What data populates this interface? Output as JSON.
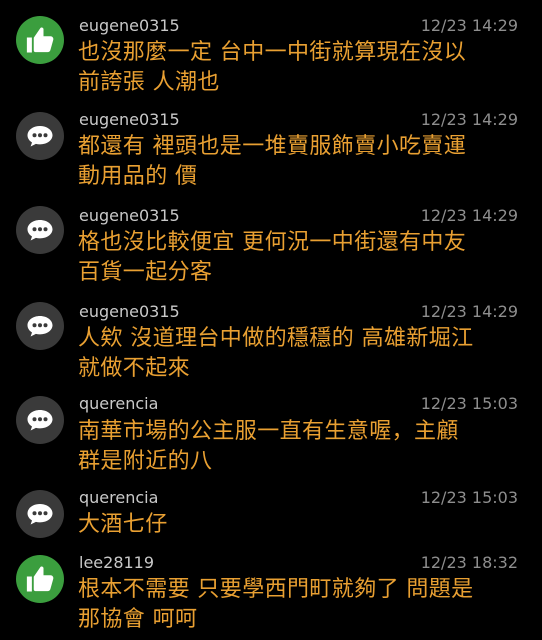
{
  "comments": [
    {
      "type": "push",
      "avatar_icon": "thumbs-up-icon",
      "user": "eugene0315",
      "time": "12/23 14:29",
      "lines": [
        "也沒那麼一定 台中一中街就算現在沒以",
        "前誇張 人潮也"
      ]
    },
    {
      "type": "neutral",
      "avatar_icon": "speech-bubble-icon",
      "user": "eugene0315",
      "time": "12/23 14:29",
      "lines": [
        "都還有 裡頭也是一堆賣服飾賣小吃賣運",
        "動用品的 價"
      ]
    },
    {
      "type": "neutral",
      "avatar_icon": "speech-bubble-icon",
      "user": "eugene0315",
      "time": "12/23 14:29",
      "lines": [
        "格也沒比較便宜 更何況一中街還有中友",
        "百貨一起分客"
      ]
    },
    {
      "type": "neutral",
      "avatar_icon": "speech-bubble-icon",
      "user": "eugene0315",
      "time": "12/23 14:29",
      "lines": [
        "人欸 沒道理台中做的穩穩的 高雄新堀江",
        "就做不起來"
      ]
    },
    {
      "type": "neutral",
      "avatar_icon": "speech-bubble-icon",
      "user": "querencia",
      "time": "12/23 15:03",
      "lines": [
        "南華市場的公主服一直有生意喔，主顧",
        "群是附近的八"
      ]
    },
    {
      "type": "neutral",
      "avatar_icon": "speech-bubble-icon",
      "user": "querencia",
      "time": "12/23 15:03",
      "lines": [
        "大酒七仔"
      ]
    },
    {
      "type": "push",
      "avatar_icon": "thumbs-up-icon",
      "user": "lee28119",
      "time": "12/23 18:32",
      "lines": [
        "根本不需要 只要學西門町就夠了 問題是",
        "那協會 呵呵"
      ]
    }
  ],
  "colors": {
    "background": "#000000",
    "push_avatar": "#3b9e3e",
    "neutral_avatar": "#3a3a3a",
    "username": "#c9c9c9",
    "time": "#8e8e8e",
    "content": "#e9a032"
  }
}
